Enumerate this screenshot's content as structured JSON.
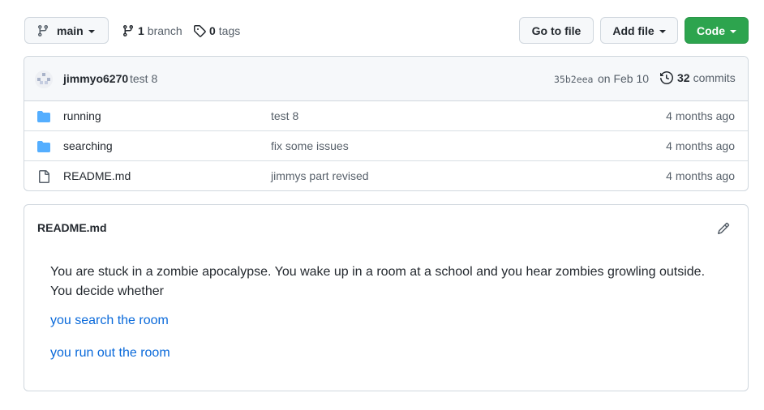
{
  "toolbar": {
    "branch_name": "main",
    "branch_count": "1",
    "branch_label": "branch",
    "tag_count": "0",
    "tag_label": "tags",
    "go_to_file": "Go to file",
    "add_file": "Add file",
    "code": "Code"
  },
  "commit": {
    "author": "jimmyo6270",
    "message": "test 8",
    "sha": "35b2eea",
    "date": "on Feb 10",
    "count": "32",
    "count_label": "commits"
  },
  "files": [
    {
      "type": "folder",
      "name": "running",
      "message": "test 8",
      "age": "4 months ago"
    },
    {
      "type": "folder",
      "name": "searching",
      "message": "fix some issues",
      "age": "4 months ago"
    },
    {
      "type": "file",
      "name": "README.md",
      "message": "jimmys part revised",
      "age": "4 months ago"
    }
  ],
  "readme": {
    "title": "README.md",
    "body": "You are stuck in a zombie apocalypse. You wake up in a room at a school and you hear zombies growling outside. You decide whether",
    "link_1": "you search the room",
    "link_2": "you run out the room"
  },
  "colors": {
    "code_button": "#2da44e",
    "link": "#0969da",
    "folder_icon": "#54aeff"
  }
}
